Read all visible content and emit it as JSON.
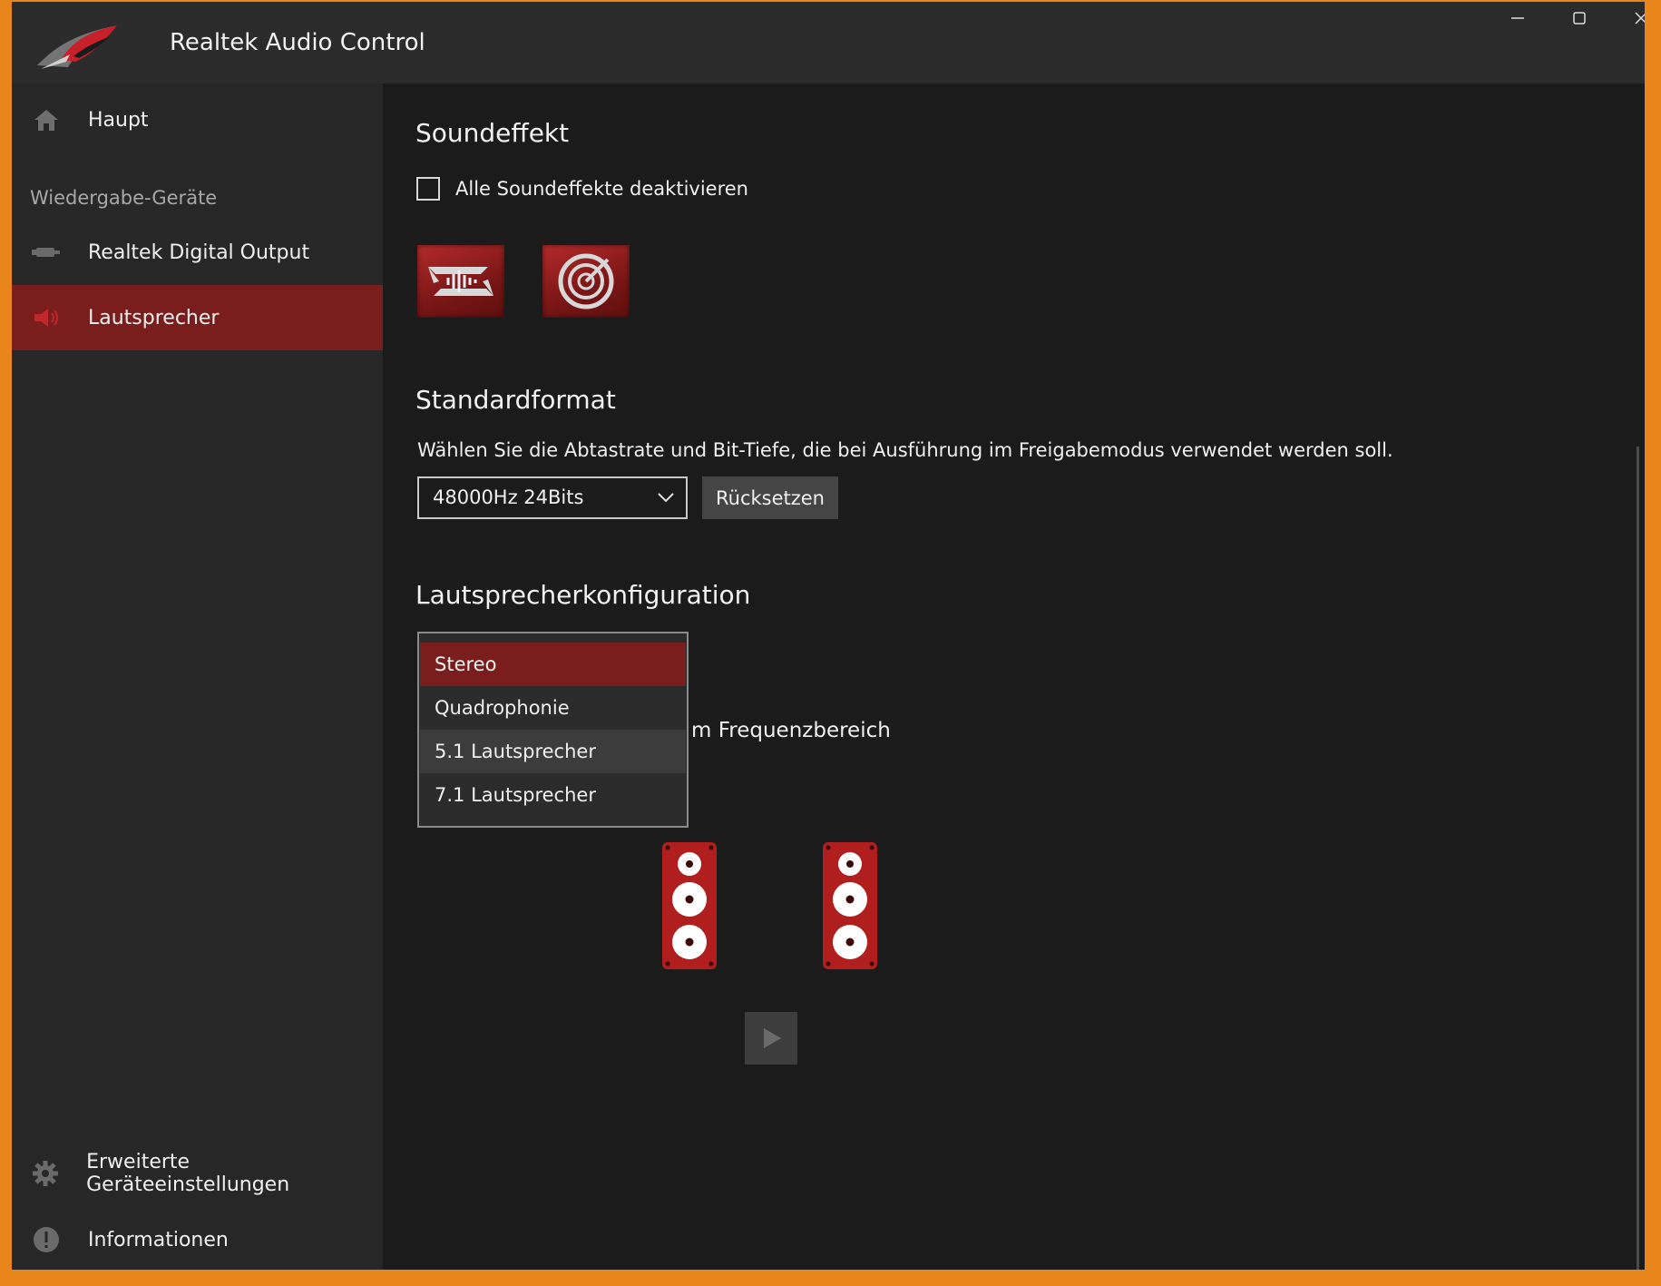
{
  "app": {
    "title": "Realtek Audio Control"
  },
  "sidebar": {
    "home_label": "Haupt",
    "section_label": "Wiedergabe-Geräte",
    "devices": [
      {
        "label": "Realtek Digital Output",
        "icon": "digital-output-icon"
      },
      {
        "label": "Lautsprecher",
        "icon": "speaker-icon",
        "active": true
      }
    ],
    "advanced_label": "Erweiterte Geräteeinstellungen",
    "info_label": "Informationen"
  },
  "main": {
    "sound_effect": {
      "title": "Soundeffekt",
      "disable_all_label": "Alle Soundeffekte deaktivieren",
      "disable_all_checked": false
    },
    "default_format": {
      "title": "Standardformat",
      "description": "Wählen Sie die Abtastrate und Bit-Tiefe, die bei Ausführung im Freigabemodus verwendet werden soll.",
      "selected": "48000Hz 24Bits",
      "reset_label": "Rücksetzen"
    },
    "speaker_config": {
      "title": "Lautsprecherkonfiguration",
      "options": [
        "Stereo",
        "Quadrophonie",
        "5.1 Lautsprecher",
        "7.1 Lautsprecher"
      ],
      "selected": "Stereo",
      "hovered": "5.1 Lautsprecher",
      "partial_hidden_text": "m Frequenzbereich"
    }
  },
  "colors": {
    "accent": "#7a1d1d",
    "speaker_red": "#b01e1e",
    "frame": "#e8861c"
  }
}
